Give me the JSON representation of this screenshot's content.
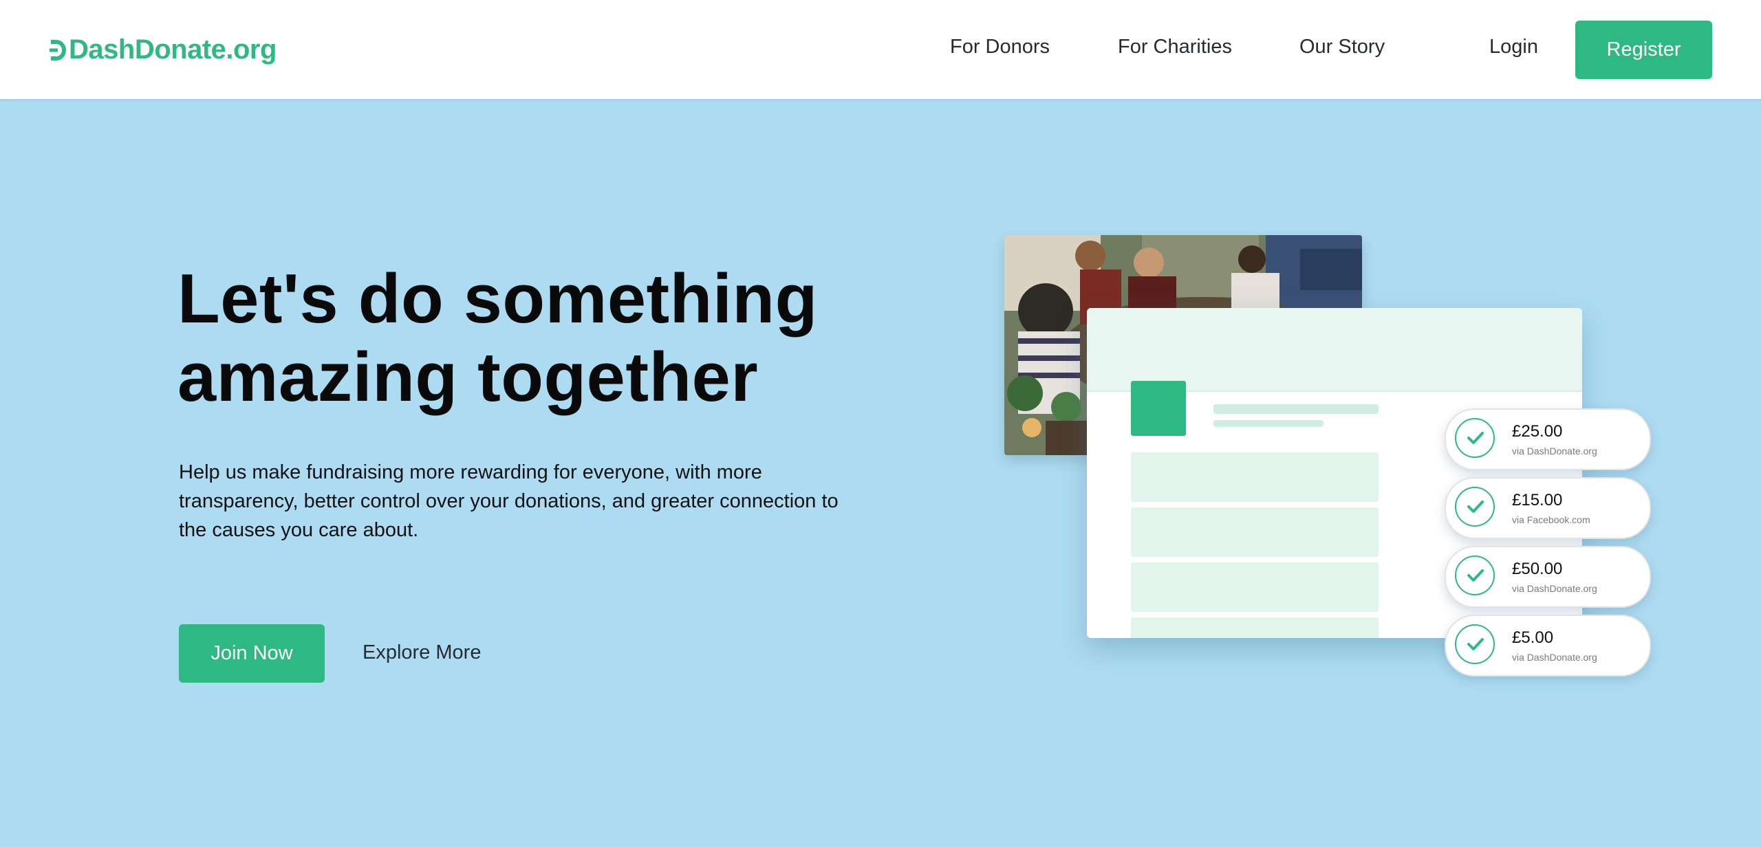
{
  "header": {
    "logo_text": "DashDonate.org",
    "nav": {
      "for_donors": "For Donors",
      "for_charities": "For Charities",
      "our_story": "Our Story",
      "login": "Login"
    },
    "register_label": "Register"
  },
  "hero": {
    "title_line1": "Let's do something",
    "title_line2": "amazing together",
    "description": "Help us make fundraising more rewarding for everyone, with more transparency, better control over your donations, and greater connection to the causes you care about.",
    "join_label": "Join Now",
    "explore_label": "Explore More"
  },
  "donations": [
    {
      "amount": "£25.00",
      "via": "via DashDonate.org"
    },
    {
      "amount": "£15.00",
      "via": "via Facebook.com"
    },
    {
      "amount": "£50.00",
      "via": "via DashDonate.org"
    },
    {
      "amount": "£5.00",
      "via": "via DashDonate.org"
    }
  ],
  "colors": {
    "brand_green": "#2eb982",
    "hero_background": "#addcf2",
    "card_tint": "#e8f6f1"
  },
  "icons": {
    "logo_mark": "dash-d-logo-icon",
    "donation_status": "check-icon"
  }
}
